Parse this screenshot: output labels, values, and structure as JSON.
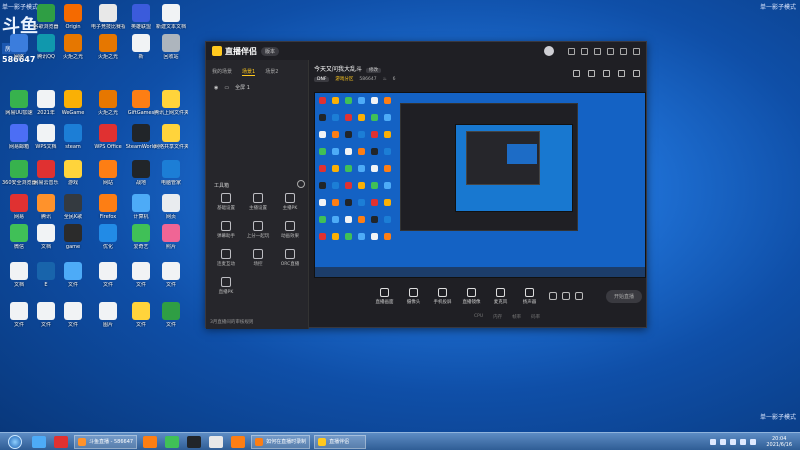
{
  "watermark": {
    "top_left": "单一影子模式",
    "top_right": "单一影子模式",
    "bottom_right": "单一影子模式"
  },
  "overlay": {
    "logo": "斗鱼",
    "room_label": "房间号",
    "room_number": "586647"
  },
  "desktop_icons": [
    {
      "label": "谷歌浏览器",
      "color": "#2f9e44"
    },
    {
      "label": "Origin",
      "color": "#f56a00"
    },
    {
      "label": "电子竞技比赛视频",
      "color": "#e8e8e8"
    },
    {
      "label": "英雄联盟",
      "color": "#3b5bdb"
    },
    {
      "label": "新建文本文档",
      "color": "#f1f3f5"
    },
    {
      "label": "网络",
      "color": "#3b7ddd"
    },
    {
      "label": "腾讯QQ",
      "color": "#1098ad"
    },
    {
      "label": "火炬之光",
      "color": "#e67700"
    },
    {
      "label": "火炬之光",
      "color": "#e67700"
    },
    {
      "label": "新",
      "color": "#f1f3f5"
    },
    {
      "label": "回收站",
      "color": "#adb5bd"
    },
    {
      "label": "网易UU加速",
      "color": "#37b24d"
    },
    {
      "label": "2021年",
      "color": "#f1f3f5"
    },
    {
      "label": "WeGame",
      "color": "#fab005"
    },
    {
      "label": "火炬之光",
      "color": "#e67700"
    },
    {
      "label": "GiftGames",
      "color": "#fd7e14"
    },
    {
      "label": "腾讯上网文件夹",
      "color": "#ffd43b"
    },
    {
      "label": "网易邮箱",
      "color": "#4c6ef5"
    },
    {
      "label": "WPS文档",
      "color": "#f1f3f5"
    },
    {
      "label": "steam",
      "color": "#1c7ed6"
    },
    {
      "label": "WPS Office",
      "color": "#e03131"
    },
    {
      "label": "SteamWorld",
      "color": "#212529"
    },
    {
      "label": "网络共享文件夹",
      "color": "#ffd43b"
    },
    {
      "label": "360安全浏览器",
      "color": "#37b24d"
    },
    {
      "label": "网易云音乐",
      "color": "#e03131"
    },
    {
      "label": "游戏",
      "color": "#ffd43b"
    },
    {
      "label": "网站",
      "color": "#fd7e14"
    },
    {
      "label": "战地",
      "color": "#212529"
    },
    {
      "label": "电脑管家",
      "color": "#1c7ed6"
    },
    {
      "label": "网易",
      "color": "#e03131"
    },
    {
      "label": "腾讯",
      "color": "#ff922b"
    },
    {
      "label": "全民K歌",
      "color": "#343a40"
    },
    {
      "label": "Firefox",
      "color": "#fd7e14"
    },
    {
      "label": "计算机",
      "color": "#4dabf7"
    },
    {
      "label": "网页",
      "color": "#e9ecef"
    },
    {
      "label": "微信",
      "color": "#40c057"
    },
    {
      "label": "文档",
      "color": "#f1f3f5"
    },
    {
      "label": "game",
      "color": "#2b2b2b"
    },
    {
      "label": "优化",
      "color": "#228be6"
    },
    {
      "label": "爱奇艺",
      "color": "#40c057"
    },
    {
      "label": "照片",
      "color": "#f06595"
    },
    {
      "label": "文档",
      "color": "#f1f3f5"
    },
    {
      "label": "E",
      "color": "#1864ab"
    },
    {
      "label": "文件",
      "color": "#4dabf7"
    },
    {
      "label": "文件",
      "color": "#f1f3f5"
    },
    {
      "label": "文件",
      "color": "#f1f3f5"
    },
    {
      "label": "文件",
      "color": "#f1f3f5"
    },
    {
      "label": "文件",
      "color": "#f1f3f5"
    },
    {
      "label": "文件",
      "color": "#f1f3f5"
    },
    {
      "label": "文件",
      "color": "#f1f3f5"
    },
    {
      "label": "图片",
      "color": "#f1f3f5"
    },
    {
      "label": "文件",
      "color": "#ffd43b"
    },
    {
      "label": "文件",
      "color": "#2f9e44"
    }
  ],
  "app": {
    "title": "直播伴侣",
    "version": "版本",
    "tabs": [
      "我的场景",
      "场景1",
      "场景2"
    ],
    "scene_item": "全屏 1",
    "tools_title": "工具箱",
    "tools": [
      "基础设置",
      "主播设置",
      "主播PK",
      "弹幕助手",
      "上分一起玩",
      "动画效果",
      "连麦互动",
      "场控",
      "ORC直播",
      "直播PK"
    ],
    "footer": "3月直播间的审核规则",
    "room_title": "今天又问我大乱斗",
    "room_edit": "修改",
    "room_tag": "DNF",
    "room_category": "游戏分区",
    "room_id": "586647",
    "room_hot": "6",
    "controls": [
      "直播画面",
      "摄像头",
      "手机投屏",
      "直播镜像",
      "麦克风",
      "扬声器"
    ],
    "start_live": "开始直播",
    "status": [
      "CPU",
      "内存",
      "帧率",
      "码率"
    ]
  },
  "taskbar": {
    "tasks": [
      "斗鱼直播 - 586647",
      "如何在直播时录制",
      "直播伴侣"
    ],
    "time": "20:04",
    "date": "2021/6/16"
  }
}
